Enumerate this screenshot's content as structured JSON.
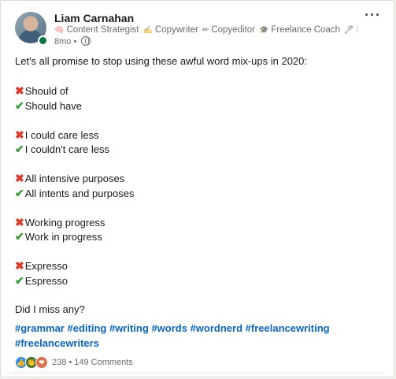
{
  "author": {
    "name": "Liam Carnahan",
    "headline": [
      {
        "icon": "brain-icon",
        "glyph": "🧠",
        "text": "Content Strategist"
      },
      {
        "icon": "writing-hand-icon",
        "glyph": "✍",
        "text": "Copywriter"
      },
      {
        "icon": "pencil-icon",
        "glyph": "✏",
        "text": "Copyeditor"
      },
      {
        "icon": "graduation-cap-icon",
        "glyph": "🎓",
        "text": "Freelance Coach"
      },
      {
        "icon": "pen-icon",
        "glyph": "🖊",
        "text": "P..."
      }
    ],
    "time": "8mo",
    "separator": "•",
    "visibility_icon": "globe-icon"
  },
  "menu": {
    "more_label": "···"
  },
  "post": {
    "intro": "Let's all promise to stop using these awful word mix-ups in 2020:",
    "pairs": [
      {
        "wrong": "Should of",
        "right": "Should have"
      },
      {
        "wrong": "I could care less",
        "right": "I couldn't care less"
      },
      {
        "wrong": "All intensive purposes",
        "right": "All intents and purposes"
      },
      {
        "wrong": "Working progress",
        "right": "Work in progress"
      },
      {
        "wrong": "Expresso",
        "right": "Espresso"
      }
    ],
    "wrong_icon": "cross-mark-icon",
    "right_icon": "check-mark-icon",
    "outro": "Did I miss any?",
    "hashtags": [
      "#grammar",
      "#editing",
      "#writing",
      "#words",
      "#wordnerd",
      "#freelancewriting",
      "#freelancewriters"
    ]
  },
  "social": {
    "reactions": [
      {
        "icon": "like-icon",
        "glyph": "👍"
      },
      {
        "icon": "celebrate-icon",
        "glyph": "👏"
      },
      {
        "icon": "love-icon",
        "glyph": "❤"
      }
    ],
    "reaction_count": "238",
    "separator": "•",
    "comments": "149 Comments"
  },
  "colors": {
    "link": "#0a66c2",
    "wrong": "#dd3b2a",
    "right": "#3a9a3a",
    "online": "#057642"
  }
}
